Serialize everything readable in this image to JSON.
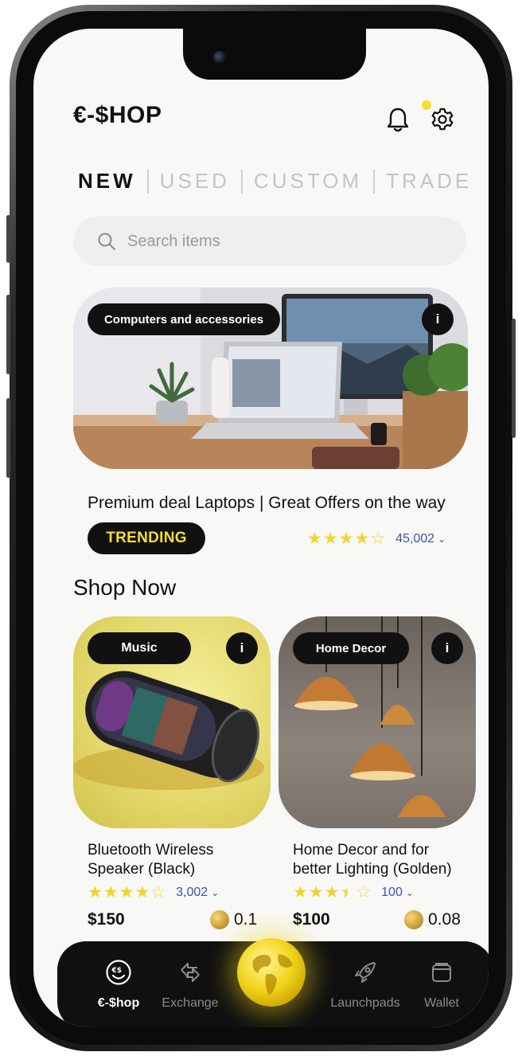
{
  "header": {
    "brand": "€-$HOP",
    "notification_icon": "bell-icon",
    "settings_icon": "gear-icon"
  },
  "tabs": [
    {
      "label": "NEW",
      "active": true
    },
    {
      "label": "USED",
      "active": false
    },
    {
      "label": "CUSTOM",
      "active": false
    },
    {
      "label": "TRADE",
      "active": false
    }
  ],
  "search": {
    "placeholder": "Search items"
  },
  "hero": {
    "category": "Computers and accessories",
    "info": "i",
    "title": "Premium deal Laptops | Great Offers on the way",
    "badge": "TRENDING",
    "rating": 4,
    "reviews": "45,002"
  },
  "section_title": "Shop Now",
  "products": [
    {
      "category": "Music",
      "info": "i",
      "title_line1": "Bluetooth Wireless",
      "title_line2": "Speaker (Black)",
      "rating": 4,
      "reviews": "3,002",
      "price": "$150",
      "coin_price": "0.1"
    },
    {
      "category": "Home Decor",
      "info": "i",
      "title_line1": "Home Decor and for",
      "title_line2": "better Lighting (Golden)",
      "rating": 3.5,
      "reviews": "100",
      "price": "$100",
      "coin_price": "0.08"
    }
  ],
  "nav": {
    "items": [
      {
        "label": "€-$hop",
        "icon": "smiley-dollar-icon",
        "active": true
      },
      {
        "label": "Exchange",
        "icon": "exchange-arrows-icon",
        "active": false
      },
      {
        "label": "Launchpads",
        "icon": "rocket-icon",
        "active": false
      },
      {
        "label": "Wallet",
        "icon": "wallet-icon",
        "active": false
      }
    ],
    "center_icon": "globe-icon"
  },
  "colors": {
    "accent_yellow": "#f3df2e",
    "dark": "#111111",
    "rating_count_blue": "#3d55a8",
    "background": "#f8f8f7"
  }
}
